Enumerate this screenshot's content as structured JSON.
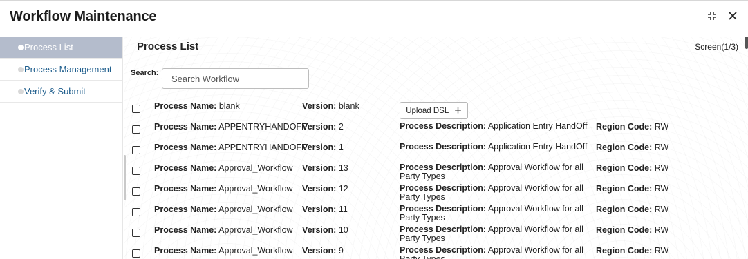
{
  "window": {
    "title": "Workflow Maintenance",
    "controls": [
      "minimize-icon",
      "close-icon"
    ]
  },
  "sidebar": {
    "items": [
      {
        "label": "Process List",
        "active": true
      },
      {
        "label": "Process Management",
        "active": false
      },
      {
        "label": "Verify & Submit",
        "active": false
      }
    ]
  },
  "main": {
    "title": "Process List",
    "screen_indicator": "Screen(1/3)",
    "search": {
      "label": "Search:",
      "placeholder": "Search Workflow",
      "value": ""
    },
    "upload_label": "Upload DSL",
    "labels": {
      "name": "Process Name:",
      "version": "Version:",
      "description": "Process Description:",
      "region": "Region Code:"
    },
    "rows": [
      {
        "name": "blank",
        "version": "blank",
        "description": "",
        "region": ""
      },
      {
        "name": "APPENTRYHANDOFF",
        "version": "2",
        "description": "Application Entry HandOff",
        "region": "RW"
      },
      {
        "name": "APPENTRYHANDOFF",
        "version": "1",
        "description": "Application Entry HandOff",
        "region": "RW"
      },
      {
        "name": "Approval_Workflow",
        "version": "13",
        "description": "Approval Workflow for all Party Types",
        "region": "RW"
      },
      {
        "name": "Approval_Workflow",
        "version": "12",
        "description": "Approval Workflow for all Party Types",
        "region": "RW"
      },
      {
        "name": "Approval_Workflow",
        "version": "11",
        "description": "Approval Workflow for all Party Types",
        "region": "RW"
      },
      {
        "name": "Approval_Workflow",
        "version": "10",
        "description": "Approval Workflow for all Party Types",
        "region": "RW"
      },
      {
        "name": "Approval_Workflow",
        "version": "9",
        "description": "Approval Workflow for all Party Types",
        "region": "RW"
      }
    ]
  }
}
